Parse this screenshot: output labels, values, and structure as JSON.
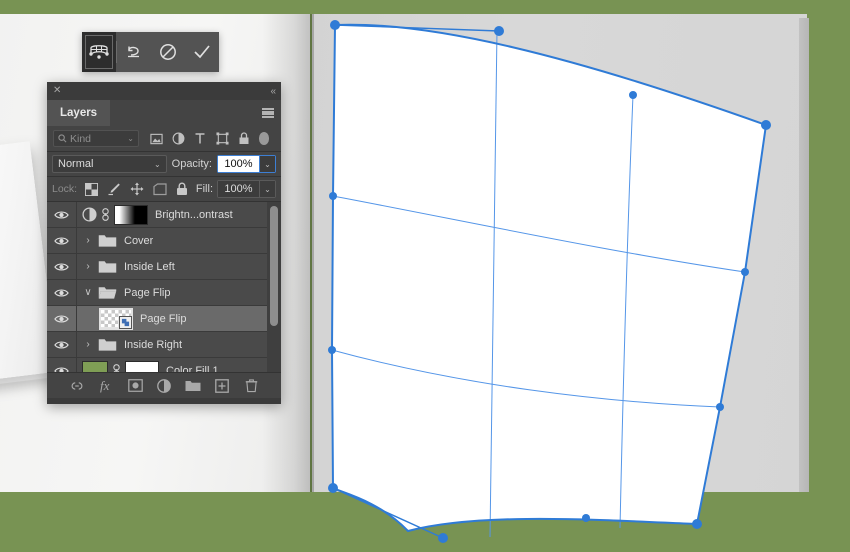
{
  "canvas": {
    "background_color": "#789353",
    "page_left_color": "#f2f2f1",
    "page_right_color": "#d5d5d5",
    "mesh_color": "#2f7bd6",
    "mesh_fill": "#ffffff"
  },
  "warp_toolbar": {
    "buttons": [
      {
        "name": "warp-grid-icon",
        "label": "Warp",
        "active": true
      },
      {
        "name": "reset-icon",
        "label": "Reset Warp",
        "active": false
      },
      {
        "name": "cancel-icon",
        "label": "Cancel Warp",
        "active": false
      },
      {
        "name": "commit-icon",
        "label": "Commit Warp",
        "active": false
      }
    ]
  },
  "layers_panel": {
    "close_label": "✕",
    "collapse_label": "«",
    "tab_label": "Layers",
    "menu_label": "Panel Menu",
    "filter": {
      "kind_label": "Kind",
      "kind_caret": "⌄",
      "icons": [
        "pixel-filter-icon",
        "adjustment-filter-icon",
        "type-filter-icon",
        "shape-filter-icon",
        "smartobject-filter-icon"
      ],
      "toggle_label": "Filter Toggle"
    },
    "blend": {
      "mode": "Normal",
      "caret": "⌄",
      "opacity_label": "Opacity:",
      "opacity_value": "100%",
      "opacity_caret": "⌄"
    },
    "lock": {
      "label": "Lock:",
      "icons": [
        "lock-transparency-icon",
        "lock-pixels-icon",
        "lock-position-icon",
        "lock-artboard-icon",
        "lock-all-icon"
      ],
      "fill_label": "Fill:",
      "fill_value": "100%",
      "fill_caret": "⌄"
    },
    "layers": [
      {
        "name": "Brightn...ontrast",
        "type": "adjustment",
        "visible": true,
        "selected": false,
        "indented": false,
        "disclosure": "",
        "thumb": "gradient-mask"
      },
      {
        "name": "Cover",
        "type": "group",
        "visible": true,
        "selected": false,
        "indented": false,
        "disclosure": "›",
        "thumb": "folder-closed"
      },
      {
        "name": "Inside Left",
        "type": "group",
        "visible": true,
        "selected": false,
        "indented": false,
        "disclosure": "›",
        "thumb": "folder-closed"
      },
      {
        "name": "Page Flip",
        "type": "group",
        "visible": true,
        "selected": false,
        "indented": false,
        "disclosure": "∨",
        "thumb": "folder-open"
      },
      {
        "name": "Page Flip",
        "type": "smart-object",
        "visible": true,
        "selected": true,
        "indented": true,
        "disclosure": "",
        "thumb": "checker-smartobject"
      },
      {
        "name": "Inside Right",
        "type": "group",
        "visible": true,
        "selected": false,
        "indented": false,
        "disclosure": "›",
        "thumb": "folder-closed"
      },
      {
        "name": "Color Fill 1",
        "type": "fill",
        "visible": true,
        "selected": false,
        "indented": false,
        "disclosure": "",
        "thumb": "solid-green",
        "swatch_color": "#7f9e55"
      }
    ],
    "footer_icons": [
      "link-layers-icon",
      "layer-style-icon",
      "layer-mask-icon",
      "adjustment-layer-icon",
      "new-group-icon",
      "new-layer-icon",
      "delete-layer-icon"
    ]
  }
}
